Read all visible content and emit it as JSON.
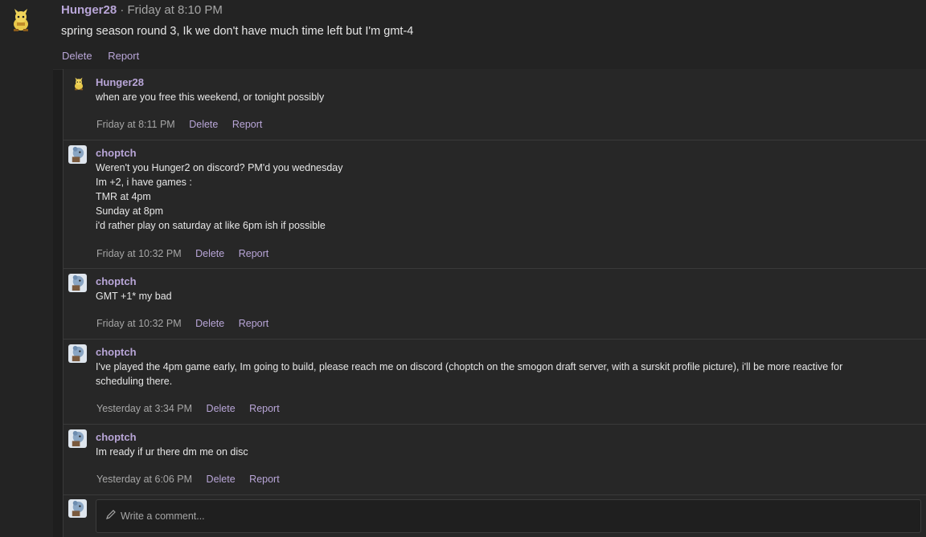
{
  "post": {
    "author": "Hunger28",
    "time": " · Friday at 8:10 PM",
    "body": "spring season round 3, Ik we don't have much time left but I'm gmt-4",
    "delete_label": "Delete",
    "report_label": "Report"
  },
  "comments": [
    {
      "author": "Hunger28",
      "lines": [
        "when are you free this weekend, or tonight possibly"
      ],
      "time": "Friday at 8:11 PM",
      "delete_label": "Delete",
      "report_label": "Report"
    },
    {
      "author": "choptch",
      "lines": [
        "Weren't you Hunger2 on discord? PM'd you wednesday",
        "Im +2, i have games :",
        "TMR at 4pm",
        "Sunday at 8pm",
        "i'd rather play on saturday at like 6pm ish if possible"
      ],
      "time": "Friday at 10:32 PM",
      "delete_label": "Delete",
      "report_label": "Report"
    },
    {
      "author": "choptch",
      "lines": [
        "GMT +1* my bad"
      ],
      "time": "Friday at 10:32 PM",
      "delete_label": "Delete",
      "report_label": "Report"
    },
    {
      "author": "choptch",
      "lines": [
        "I've played the 4pm game early, Im going to build, please reach me on discord (choptch on the smogon draft server, with a surskit profile picture), i'll be more reactive for",
        "scheduling there."
      ],
      "time": "Yesterday at 3:34 PM",
      "delete_label": "Delete",
      "report_label": "Report"
    },
    {
      "author": "choptch",
      "lines": [
        "Im ready if ur there dm me on disc"
      ],
      "time": "Yesterday at 6:06 PM",
      "delete_label": "Delete",
      "report_label": "Report"
    }
  ],
  "composer": {
    "placeholder": "Write a comment..."
  },
  "colors": {
    "accent": "#b9a6d8",
    "background": "#1e1e1e",
    "panel": "#272727"
  }
}
